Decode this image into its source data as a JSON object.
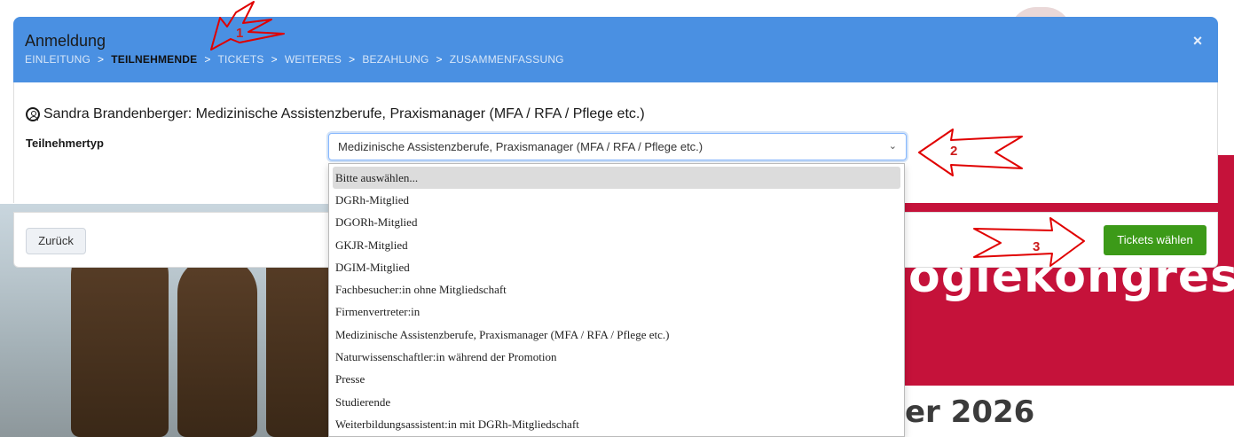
{
  "modal": {
    "title": "Anmeldung",
    "breadcrumb": [
      {
        "label": "EINLEITUNG",
        "active": false
      },
      {
        "label": "TEILNEHMENDE",
        "active": true
      },
      {
        "label": "TICKETS",
        "active": false
      },
      {
        "label": "WEITERES",
        "active": false
      },
      {
        "label": "BEZAHLUNG",
        "active": false
      },
      {
        "label": "ZUSAMMENFASSUNG",
        "active": false
      }
    ],
    "separator": ">",
    "close_icon": "×",
    "participant": "Sandra Brandenberger: Medizinische Assistenzberufe, Praxismanager (MFA / RFA / Pflege etc.)",
    "field_label": "Teilnehmertyp",
    "selected_value": "Medizinische Assistenzberufe, Praxismanager (MFA / RFA / Pflege etc.)",
    "back_label": "Zurück",
    "tickets_label": "Tickets wählen"
  },
  "dropdown": {
    "options": [
      "Bitte auswählen...",
      "DGRh-Mitglied",
      "DGORh-Mitglied",
      "GKJR-Mitglied",
      "DGIM-Mitglied",
      "Fachbesucher:in ohne Mitgliedschaft",
      "Firmenvertreter:in",
      "Medizinische Assistenzberufe, Praxismanager (MFA / RFA / Pflege etc.)",
      "Naturwissenschaftler:in während der Promotion",
      "Presse",
      "Studierende",
      "Weiterbildungsassistent:in mit DGRh-Mitgliedschaft"
    ],
    "highlighted_index": 0
  },
  "background": {
    "banner_text": "ogiekongress",
    "year_text": "er 2026"
  },
  "annotations": [
    {
      "label": "1",
      "icon": "arrow-down-left-icon"
    },
    {
      "label": "2",
      "icon": "arrow-left-icon"
    },
    {
      "label": "3",
      "icon": "arrow-right-icon"
    }
  ],
  "colors": {
    "header": "#4a90e2",
    "primary_button": "#3c9a18",
    "annotation": "#e00000",
    "banner": "#c5123a"
  }
}
